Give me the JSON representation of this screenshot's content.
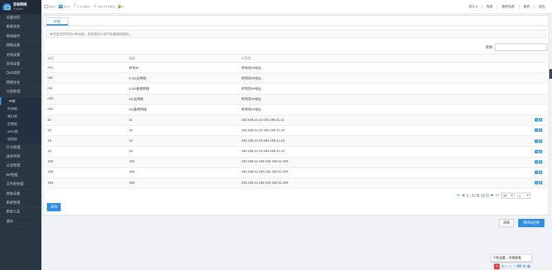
{
  "logo": {
    "cn": "吾锐网络",
    "en": "Socloud"
  },
  "sidebar": {
    "items": [
      {
        "label": "设置向导"
      },
      {
        "label": "系统状态"
      },
      {
        "label": "常用操作"
      },
      {
        "label": "网络设置"
      },
      {
        "label": "无线设置"
      },
      {
        "label": "多线设置"
      },
      {
        "label": "QoS流控"
      },
      {
        "label": "网络安全"
      },
      {
        "label": "分组管理"
      },
      {
        "label": "IP组"
      },
      {
        "label": "时间组"
      },
      {
        "label": "端口组"
      },
      {
        "label": "应用组"
      },
      {
        "label": "MAC组"
      },
      {
        "label": "域名组"
      },
      {
        "label": "行为管理"
      },
      {
        "label": "虚拟专网"
      },
      {
        "label": "认证管理"
      },
      {
        "label": "AP管理"
      },
      {
        "label": "文件柜管理"
      },
      {
        "label": "高级设置"
      },
      {
        "label": "系统管理"
      },
      {
        "label": "系统工具"
      },
      {
        "label": "退出"
      }
    ]
  },
  "topbar": {
    "cpu": "16%",
    "mem_icon": "MEM",
    "mem": "11%",
    "up": "2.1 MB/s",
    "down": "164.79 KB/s",
    "users": "6",
    "links": [
      "语言 ▾",
      "帮助",
      "维修指南",
      "重启",
      "退出"
    ]
  },
  "tab": "IP组",
  "note": "本页显示所有的IP地址组。系统预设义组不能编辑和删除。",
  "search": {
    "label": "搜索:",
    "value": ""
  },
  "table": {
    "headers": [
      "组名",
      "描述",
      "IP范围",
      ""
    ],
    "rows": [
      {
        "name": "ALL",
        "desc": "所有IP",
        "range": "所有的IP地址",
        "editable": false
      },
      {
        "name": "ra0",
        "desc": "2.4G主网络",
        "range": "所有的IP地址",
        "editable": false
      },
      {
        "name": "ra1",
        "desc": "2.4G备用网络",
        "range": "所有的IP地址",
        "editable": false
      },
      {
        "name": "rai0",
        "desc": "5G主网络",
        "range": "所有的IP地址",
        "editable": false
      },
      {
        "name": "rai1",
        "desc": "5G备用网络",
        "range": "所有的IP地址",
        "editable": false
      },
      {
        "name": "11",
        "desc": "11",
        "range": "192.168.11.11-192.168.11.11",
        "editable": true
      },
      {
        "name": "12",
        "desc": "12",
        "range": "192.168.11.12-192.168.11.12",
        "editable": true
      },
      {
        "name": "13",
        "desc": "13",
        "range": "192.168.11.13-192.168.11.13",
        "editable": true
      },
      {
        "name": "14",
        "desc": "14",
        "range": "192.168.11.14-192.168.11.14",
        "editable": true
      },
      {
        "name": "105",
        "desc": "105",
        "range": "192.168.11.105-192.168.11.105",
        "editable": true
      },
      {
        "name": "106",
        "desc": "106",
        "range": "192.168.11.106-192.168.11.106",
        "editable": true
      },
      {
        "name": "155",
        "desc": "155",
        "range": "192.168.11.155-192.168.11.155",
        "editable": true
      }
    ]
  },
  "pager": {
    "summary": "1 - 12 共 12 行",
    "page_size": "30",
    "page": "1"
  },
  "buttons": {
    "add": "添加",
    "clear": "清除",
    "save": "保存&应用"
  },
  "tooltip": "个性设置，点我看看",
  "tray": {
    "ime": "S",
    "lang": "中"
  },
  "colors": {
    "accent": "#2f8ee8",
    "sidebar_bg": "#2b3643"
  }
}
